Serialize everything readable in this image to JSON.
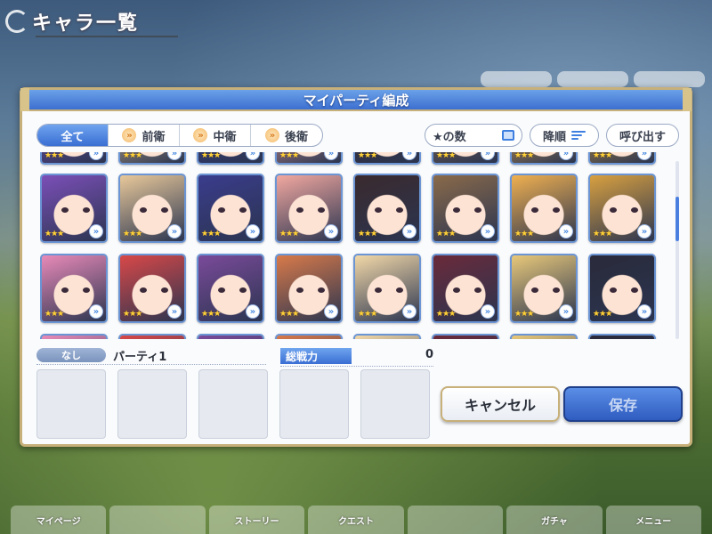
{
  "header": {
    "title": "キャラ一覧"
  },
  "dialog": {
    "title": "マイパーティ編成",
    "tabs": [
      {
        "label": "全て",
        "active": true
      },
      {
        "label": "前衛",
        "active": false
      },
      {
        "label": "中衛",
        "active": false
      },
      {
        "label": "後衛",
        "active": false
      }
    ],
    "controls": {
      "star_count": "★の数",
      "sort": "降順",
      "call": "呼び出す"
    },
    "characters": [
      {
        "row": 1,
        "hue": "#7b4fb8",
        "stars": "★★★"
      },
      {
        "row": 1,
        "hue": "#e8c89a",
        "stars": "★★★"
      },
      {
        "row": 1,
        "hue": "#3a3c8c",
        "stars": "★★★"
      },
      {
        "row": 1,
        "hue": "#f2a8a0",
        "stars": "★★★"
      },
      {
        "row": 1,
        "hue": "#3a2a2e",
        "stars": "★★★"
      },
      {
        "row": 1,
        "hue": "#8a6a4a",
        "stars": "★★★"
      },
      {
        "row": 1,
        "hue": "#f0b050",
        "stars": "★★★"
      },
      {
        "row": 1,
        "hue": "#d8a040",
        "stars": "★★★"
      },
      {
        "row": 2,
        "hue": "#e88ab8",
        "stars": "★★★"
      },
      {
        "row": 2,
        "hue": "#d84848",
        "stars": "★★★"
      },
      {
        "row": 2,
        "hue": "#7a4a9a",
        "stars": "★★★"
      },
      {
        "row": 2,
        "hue": "#d87a4a",
        "stars": "★★★"
      },
      {
        "row": 2,
        "hue": "#f2d8a8",
        "stars": "★★★"
      },
      {
        "row": 2,
        "hue": "#6a2a3a",
        "stars": "★★★"
      },
      {
        "row": 2,
        "hue": "#e8c87a",
        "stars": "★★★"
      },
      {
        "row": 2,
        "hue": "#2a2a3a",
        "stars": "★★★"
      }
    ],
    "party": {
      "label": "なし",
      "name": "パーティ1"
    },
    "power": {
      "label": "総戦力",
      "value": "0"
    },
    "buttons": {
      "cancel": "キャンセル",
      "save": "保存"
    }
  },
  "nav": [
    "マイページ",
    "",
    "ストーリー",
    "クエスト",
    "",
    "ガチャ",
    "メニュー"
  ]
}
